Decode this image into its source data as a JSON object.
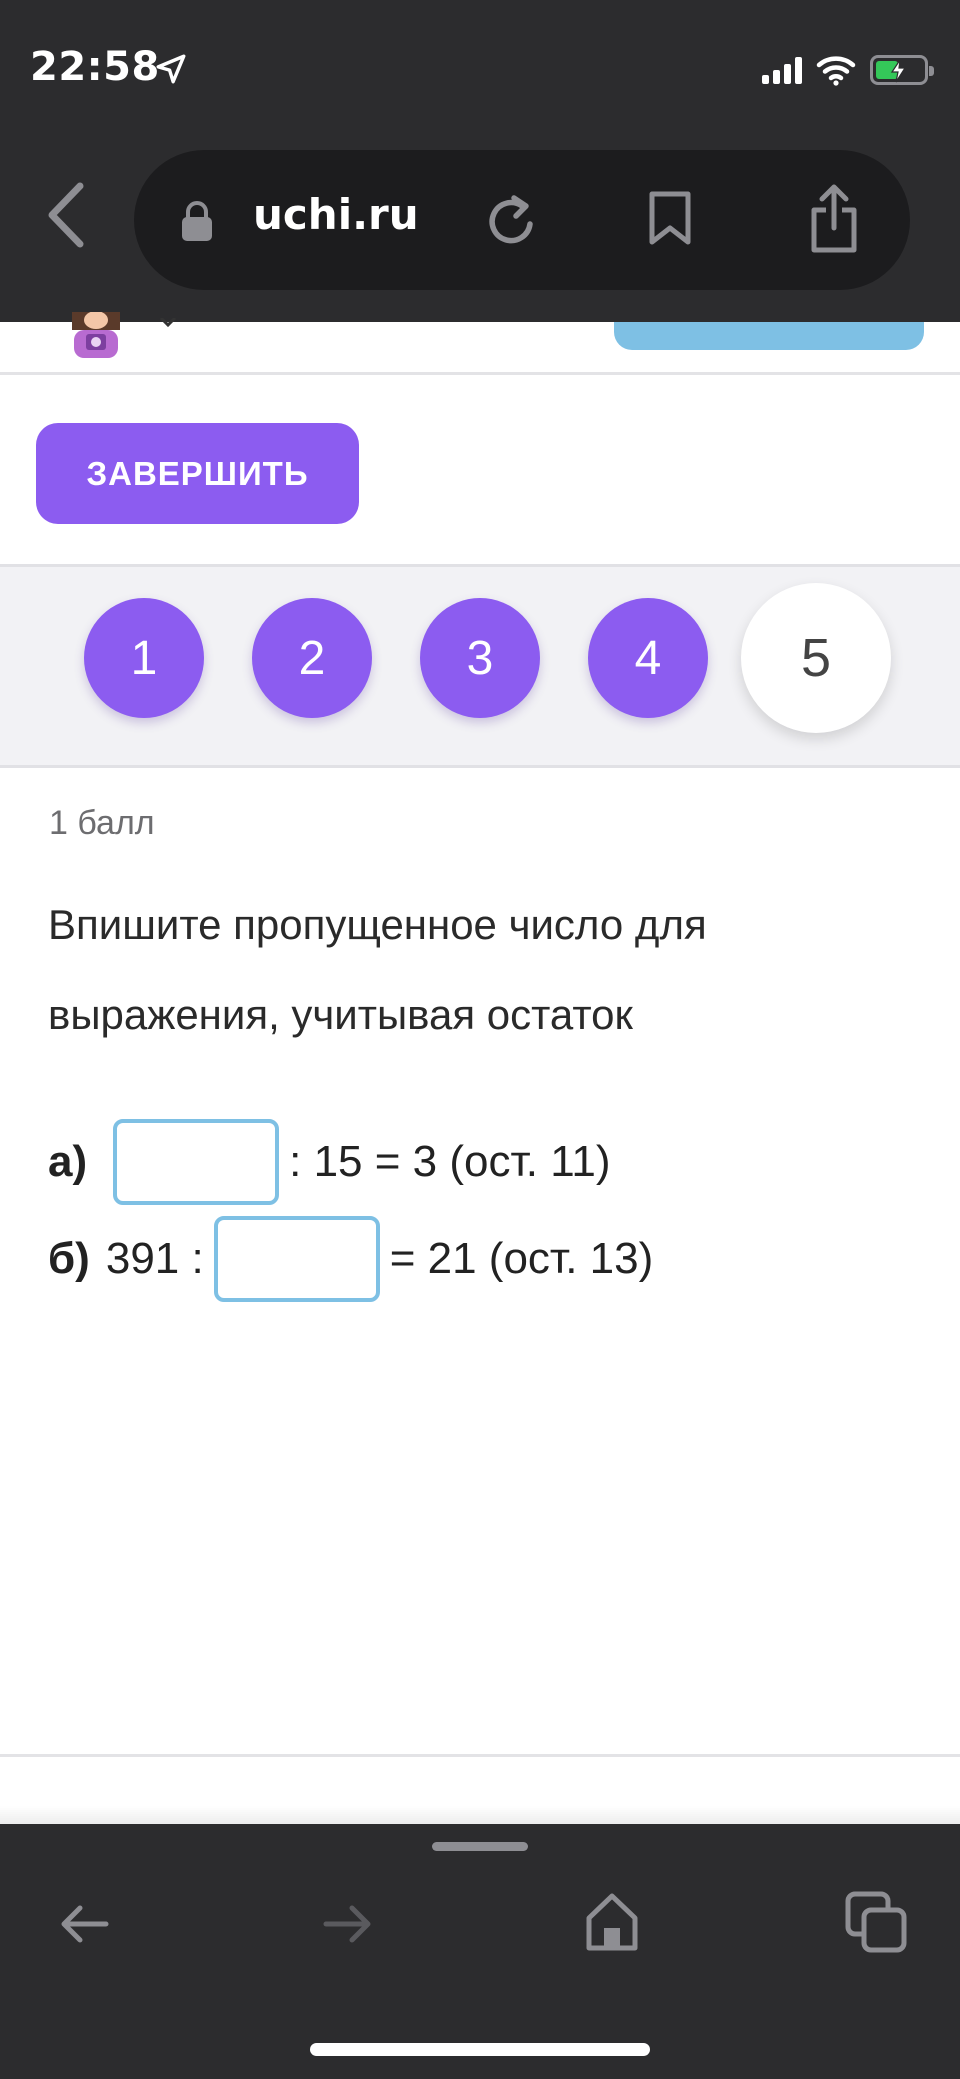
{
  "status_bar": {
    "time": "22:58"
  },
  "browser": {
    "url": "uchi.ru"
  },
  "actions": {
    "finish_label": "ЗАВЕРШИТЬ"
  },
  "question_nav": {
    "items": [
      "1",
      "2",
      "3",
      "4",
      "5"
    ],
    "active_index": 4
  },
  "task": {
    "points": "1 балл",
    "prompt": "Впишите пропущенное число для выражения, учитывая остаток",
    "a": {
      "label": "а)",
      "suffix": ": 15 = 3 (ост. 11)",
      "value": ""
    },
    "b": {
      "label": "б)",
      "prefix": "391 :",
      "suffix": "= 21 (ост. 13)",
      "value": ""
    }
  },
  "colors": {
    "accent": "#8c5cf0",
    "input_border": "#7ec0e4",
    "chrome": "#2c2c2e"
  },
  "icons": [
    "location-arrow-icon",
    "signal-icon",
    "wifi-icon",
    "battery-icon",
    "back-chevron-icon",
    "lock-icon",
    "reload-icon",
    "bookmark-icon",
    "share-icon",
    "arrow-left-icon",
    "arrow-right-icon",
    "home-icon",
    "tabs-icon"
  ]
}
